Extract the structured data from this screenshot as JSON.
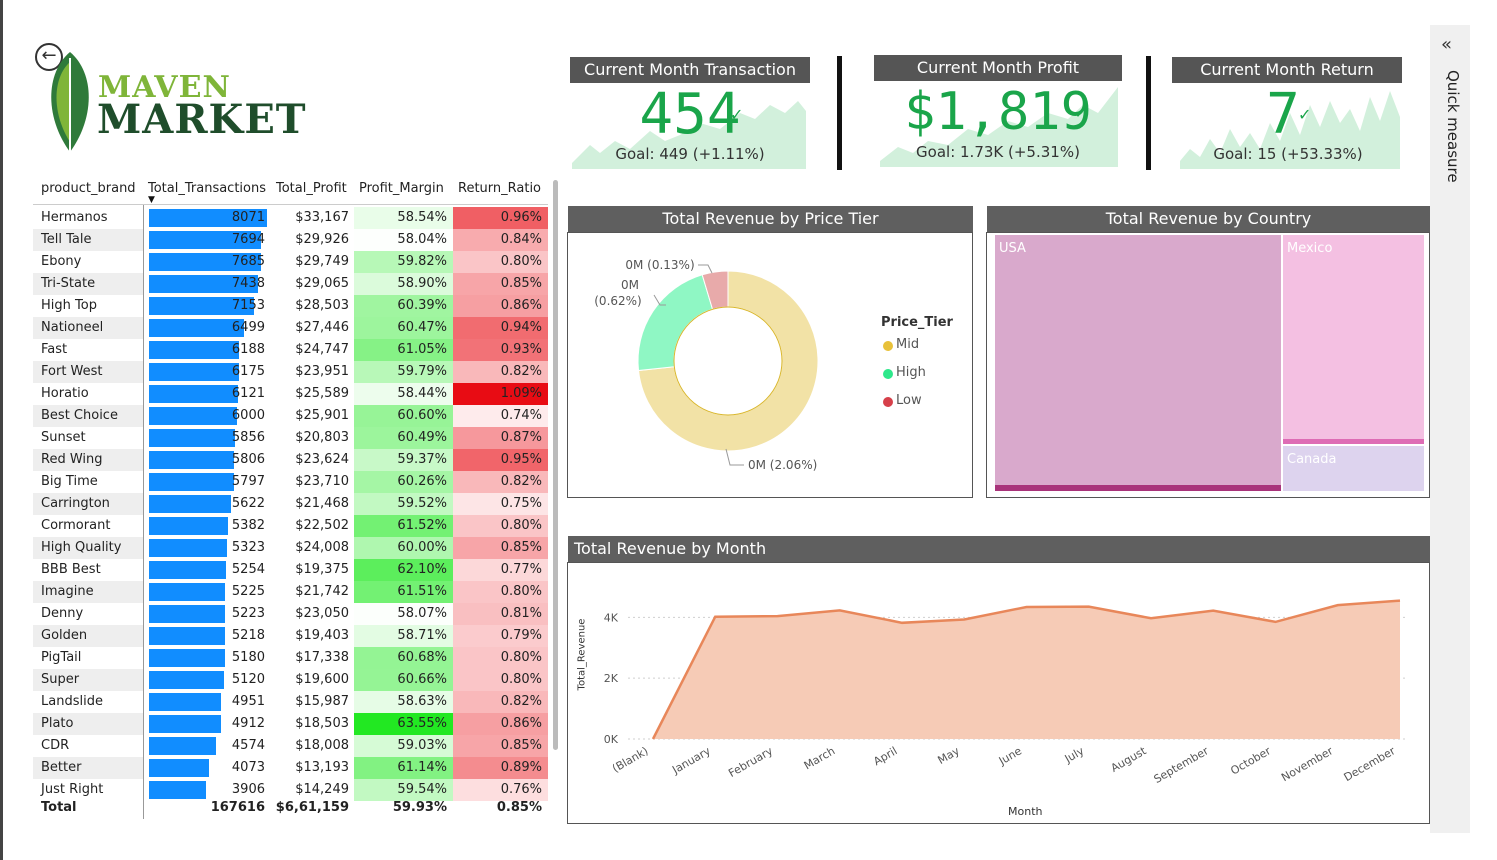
{
  "logo": {
    "line1": "MAVEN",
    "line2": "MARKET"
  },
  "quick_measure": {
    "label": "Quick measure",
    "icon": "double-chevron-left-icon"
  },
  "kpis": [
    {
      "title": "Current Month Transaction",
      "value": "454",
      "goal": "Goal: 449 (+1.11%)"
    },
    {
      "title": "Current Month Profit",
      "value": "$1,819",
      "goal": "Goal: 1.73K (+5.31%)"
    },
    {
      "title": "Current Month Return",
      "value": "7",
      "goal": "Goal: 15 (+53.33%)"
    }
  ],
  "table": {
    "headers": [
      "product_brand",
      "Total_Transactions",
      "Total_Profit",
      "Profit_Margin",
      "Return_Ratio"
    ],
    "rows": [
      [
        "Hermanos",
        "8071",
        "$33,167",
        "58.54%",
        "0.96%"
      ],
      [
        "Tell Tale",
        "7694",
        "$29,926",
        "58.04%",
        "0.84%"
      ],
      [
        "Ebony",
        "7685",
        "$29,749",
        "59.82%",
        "0.80%"
      ],
      [
        "Tri-State",
        "7438",
        "$29,065",
        "58.90%",
        "0.85%"
      ],
      [
        "High Top",
        "7153",
        "$28,503",
        "60.39%",
        "0.86%"
      ],
      [
        "Nationeel",
        "6499",
        "$27,446",
        "60.47%",
        "0.94%"
      ],
      [
        "Fast",
        "6188",
        "$24,747",
        "61.05%",
        "0.93%"
      ],
      [
        "Fort West",
        "6175",
        "$23,951",
        "59.79%",
        "0.82%"
      ],
      [
        "Horatio",
        "6121",
        "$25,589",
        "58.44%",
        "1.09%"
      ],
      [
        "Best Choice",
        "6000",
        "$25,901",
        "60.60%",
        "0.74%"
      ],
      [
        "Sunset",
        "5856",
        "$20,803",
        "60.49%",
        "0.87%"
      ],
      [
        "Red Wing",
        "5806",
        "$23,624",
        "59.37%",
        "0.95%"
      ],
      [
        "Big Time",
        "5797",
        "$23,710",
        "60.26%",
        "0.82%"
      ],
      [
        "Carrington",
        "5622",
        "$21,468",
        "59.52%",
        "0.75%"
      ],
      [
        "Cormorant",
        "5382",
        "$22,502",
        "61.52%",
        "0.80%"
      ],
      [
        "High Quality",
        "5323",
        "$24,008",
        "60.00%",
        "0.85%"
      ],
      [
        "BBB Best",
        "5254",
        "$19,375",
        "62.10%",
        "0.77%"
      ],
      [
        "Imagine",
        "5225",
        "$21,742",
        "61.51%",
        "0.80%"
      ],
      [
        "Denny",
        "5223",
        "$23,050",
        "58.07%",
        "0.81%"
      ],
      [
        "Golden",
        "5218",
        "$19,403",
        "58.71%",
        "0.79%"
      ],
      [
        "PigTail",
        "5180",
        "$17,338",
        "60.68%",
        "0.80%"
      ],
      [
        "Super",
        "5120",
        "$19,600",
        "60.66%",
        "0.80%"
      ],
      [
        "Landslide",
        "4951",
        "$15,987",
        "58.63%",
        "0.82%"
      ],
      [
        "Plato",
        "4912",
        "$18,503",
        "63.55%",
        "0.86%"
      ],
      [
        "CDR",
        "4574",
        "$18,008",
        "59.03%",
        "0.85%"
      ],
      [
        "Better",
        "4073",
        "$13,193",
        "61.14%",
        "0.89%"
      ],
      [
        "Just Right",
        "3906",
        "$14,249",
        "59.54%",
        "0.76%"
      ]
    ],
    "total": [
      "Total",
      "167616",
      "$6,61,159",
      "59.93%",
      "0.85%"
    ]
  },
  "chart_data": [
    {
      "type": "pie",
      "title": "Total Revenue by Price Tier",
      "legend_title": "Price_Tier",
      "legend_placement": "right",
      "categories": [
        "Mid",
        "High",
        "Low"
      ],
      "values": [
        2.06,
        0.62,
        0.13
      ],
      "data_labels": [
        "0M (2.06%)",
        "0M (0.62%)",
        "0M (0.13%)"
      ],
      "colors": [
        "#f2e2a6",
        "#8ff7c4",
        "#e8aaaa"
      ],
      "legend_colors": [
        "#e8c13a",
        "#2ee88b",
        "#d6404a"
      ]
    },
    {
      "type": "table",
      "title": "Total Revenue by Country",
      "categories": [
        "USA",
        "Mexico",
        "Canada"
      ],
      "colors": [
        "#d9a9cc",
        "#f4c0e2",
        "#ddd3ee"
      ]
    },
    {
      "type": "area",
      "title": "Total Revenue by Month",
      "xlabel": "Month",
      "ylabel": "Total_Revenue",
      "categories": [
        "(Blank)",
        "January",
        "February",
        "March",
        "April",
        "May",
        "June",
        "July",
        "August",
        "September",
        "October",
        "November",
        "December"
      ],
      "values": [
        0,
        4020,
        4040,
        4230,
        3820,
        3930,
        4340,
        4350,
        3970,
        4220,
        3850,
        4400,
        4550
      ],
      "yticks": [
        "0K",
        "2K",
        "4K"
      ],
      "ylim": [
        0,
        4800
      ],
      "grid": true,
      "line_color": "#e8875a",
      "fill_color": "#f6cbb6"
    }
  ]
}
